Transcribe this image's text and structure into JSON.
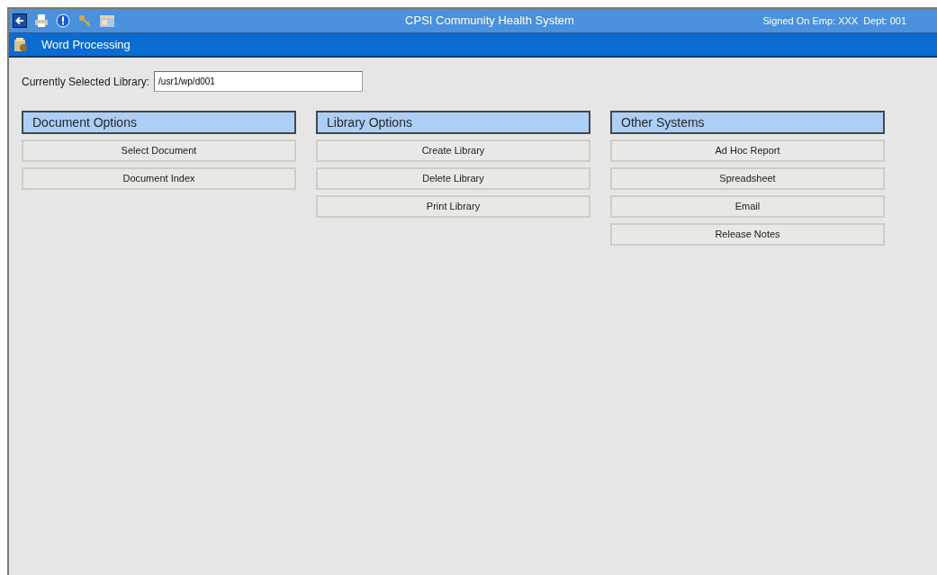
{
  "title_bar": {
    "title": "CPSI Community Health System",
    "signed_on": "Signed On Emp: XXX  Dept: 001"
  },
  "module_bar": {
    "title": "Word Processing"
  },
  "library_field": {
    "label": "Currently Selected Library:",
    "value": "/usr1/wp/d001"
  },
  "groups": [
    {
      "title": "Document Options",
      "buttons": [
        "Select Document",
        "Document Index"
      ]
    },
    {
      "title": "Library Options",
      "buttons": [
        "Create Library",
        "Delete Library",
        "Print Library"
      ]
    },
    {
      "title": "Other Systems",
      "buttons": [
        "Ad Hoc Report",
        "Spreadsheet",
        "Email",
        "Release Notes"
      ]
    }
  ]
}
